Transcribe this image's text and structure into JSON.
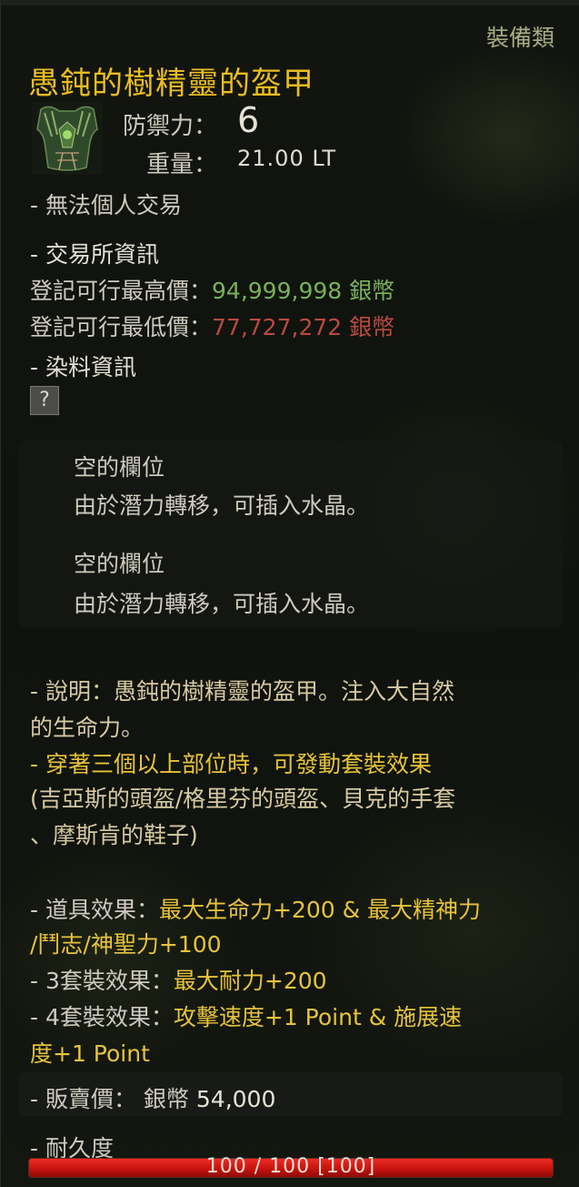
{
  "item": {
    "category": "裝備類",
    "name": "愚鈍的樹精靈的盔甲",
    "icon": "armor-icon",
    "defense_label": "防禦力：",
    "defense_value": "6",
    "weight_label": "重量：",
    "weight_value": "21.00 LT",
    "trade_restriction": "- 無法個人交易"
  },
  "market": {
    "header": "- 交易所資訊",
    "max_label": "登記可行最高價：",
    "max_value": "94,999,998",
    "max_unit": "銀幣",
    "min_label": "登記可行最低價：",
    "min_value": "77,727,272",
    "min_unit": "銀幣"
  },
  "dye": {
    "header": "- 染料資訊",
    "slot_symbol": "?"
  },
  "slots": [
    {
      "title": "空的欄位",
      "desc": "由於潛力轉移，可插入水晶。"
    },
    {
      "title": "空的欄位",
      "desc": "由於潛力轉移，可插入水晶。"
    }
  ],
  "description": {
    "line1": "- 說明：愚鈍的樹精靈的盔甲。注入大自然",
    "line2": "的生命力。",
    "set_line1": "- 穿著三個以上部位時，可發動套裝效果",
    "set_line2": "(吉亞斯的頭盔/格里芬的頭盔、貝克的手套",
    "set_line3": "、摩斯肯的鞋子)"
  },
  "effects": {
    "item_label": "- 道具效果：",
    "item_value1": "最大生命力+200 & 最大精神力",
    "item_value2": "/鬥志/神聖力+100",
    "set3_label": "- 3套裝效果：",
    "set3_value": "最大耐力+200",
    "set4_label": "- 4套裝效果：",
    "set4_value1": "攻擊速度+1 Point & 施展速",
    "set4_value2": "度+1 Point"
  },
  "sell": {
    "label": "- 販賣價：",
    "currency": "銀幣",
    "value": "54,000"
  },
  "durability": {
    "label": "- 耐久度",
    "text": "100 / 100 [100]",
    "fraction": 1.0
  },
  "colors": {
    "title": "#e9bc23",
    "category": "#a6ad83",
    "max_price": "#79b05a",
    "min_price": "#b9493f",
    "effect": "#e6c33c",
    "durability_bar": "#d81c15"
  }
}
